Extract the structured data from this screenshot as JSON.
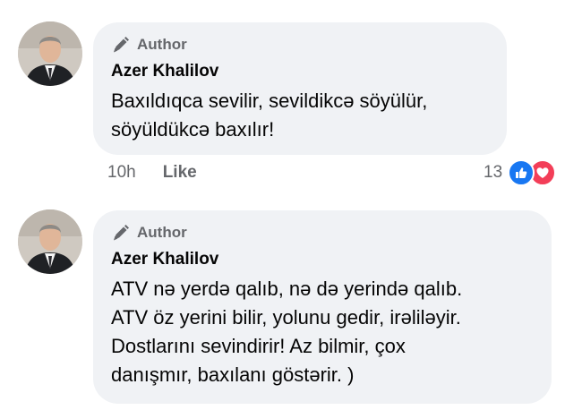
{
  "comments": [
    {
      "badge": "Author",
      "author": "Azer Khalilov",
      "text": "Baxıldıqca sevilir, sevildikcə söyülür,\nsöyüldükcə baxılır!",
      "time": "10h",
      "like_label": "Like",
      "reaction_count": "13",
      "reactions": [
        "like-icon",
        "love-icon"
      ]
    },
    {
      "badge": "Author",
      "author": "Azer Khalilov",
      "text": "ATV nə yerdə qalıb, nə də yerində qalıb.\nATV öz yerini bilir, yolunu gedir, irəliləyir.\nDostlarını sevindirir! Az bilmir, çox\ndanışmır, baxılanı göstərir. )"
    }
  ],
  "colors": {
    "bubble": "#f0f2f5",
    "meta_text": "#65676b",
    "like_blue": "#1877f2",
    "love_red": "#f33e58"
  }
}
